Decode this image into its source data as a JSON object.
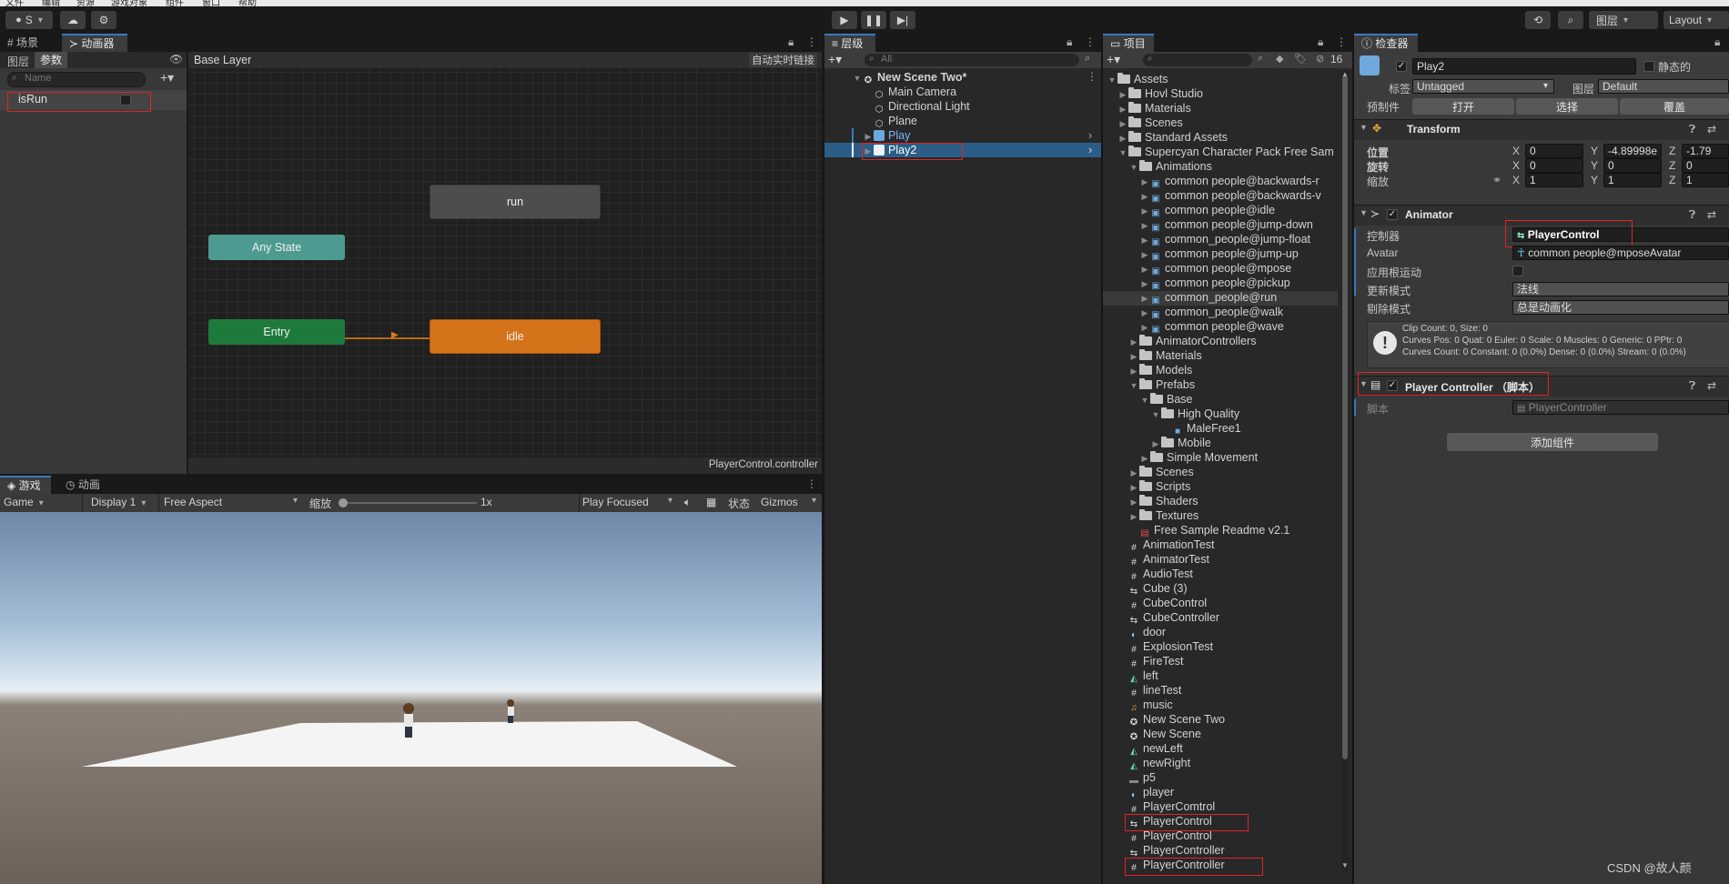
{
  "menubar": {
    "items": [
      "文件",
      "编辑",
      "资源",
      "游戏对象",
      "组件",
      "窗口",
      "帮助"
    ]
  },
  "toolbar": {
    "account": "S",
    "layers_label": "图层",
    "layout_label": "Layout"
  },
  "animator": {
    "tabs": [
      "场景",
      "动画器"
    ],
    "subtabs": [
      "图层",
      "参数"
    ],
    "breadcrumb": "Base Layer",
    "auto_live_link": "自动实时链接",
    "search_placeholder": "Name",
    "parameters": [
      {
        "name": "isRun",
        "type": "bool",
        "value": false
      }
    ],
    "states": {
      "run": "run",
      "any": "Any State",
      "entry": "Entry",
      "idle": "idle"
    },
    "footer": "PlayerControl.controller"
  },
  "game": {
    "tabs": [
      "游戏",
      "动画"
    ],
    "display_mode": "Game",
    "display": "Display 1",
    "aspect": "Free Aspect",
    "scale_label": "缩放",
    "scale_value": "1x",
    "play_mode": "Play Focused",
    "stats": "状态",
    "gizmos": "Gizmos"
  },
  "hierarchy": {
    "tab": "层级",
    "search_placeholder": "All",
    "scene": "New Scene Two*",
    "items": [
      "Main Camera",
      "Directional Light",
      "Plane",
      "Play",
      "Play2"
    ]
  },
  "project": {
    "tab": "项目",
    "hidden_count": "16",
    "tree": [
      {
        "label": "Assets",
        "depth": 0,
        "kind": "folder",
        "open": true
      },
      {
        "label": "Hovl Studio",
        "depth": 1,
        "kind": "folder"
      },
      {
        "label": "Materials",
        "depth": 1,
        "kind": "folder"
      },
      {
        "label": "Scenes",
        "depth": 1,
        "kind": "folder"
      },
      {
        "label": "Standard Assets",
        "depth": 1,
        "kind": "folder"
      },
      {
        "label": "Supercyan Character Pack Free Sam",
        "depth": 1,
        "kind": "folder",
        "open": true
      },
      {
        "label": "Animations",
        "depth": 2,
        "kind": "folder",
        "open": true
      },
      {
        "label": "common people@backwards-r",
        "depth": 3,
        "kind": "model"
      },
      {
        "label": "common people@backwards-v",
        "depth": 3,
        "kind": "model"
      },
      {
        "label": "common people@idle",
        "depth": 3,
        "kind": "model"
      },
      {
        "label": "common people@jump-down",
        "depth": 3,
        "kind": "model"
      },
      {
        "label": "common_people@jump-float",
        "depth": 3,
        "kind": "model"
      },
      {
        "label": "common people@jump-up",
        "depth": 3,
        "kind": "model"
      },
      {
        "label": "common people@mpose",
        "depth": 3,
        "kind": "model"
      },
      {
        "label": "common people@pickup",
        "depth": 3,
        "kind": "model"
      },
      {
        "label": "common_people@run",
        "depth": 3,
        "kind": "model"
      },
      {
        "label": "common_people@walk",
        "depth": 3,
        "kind": "model"
      },
      {
        "label": "common people@wave",
        "depth": 3,
        "kind": "model"
      },
      {
        "label": "AnimatorControllers",
        "depth": 2,
        "kind": "folder"
      },
      {
        "label": "Materials",
        "depth": 2,
        "kind": "folder"
      },
      {
        "label": "Models",
        "depth": 2,
        "kind": "folder"
      },
      {
        "label": "Prefabs",
        "depth": 2,
        "kind": "folder",
        "open": true
      },
      {
        "label": "Base",
        "depth": 3,
        "kind": "folder",
        "open": true
      },
      {
        "label": "High Quality",
        "depth": 4,
        "kind": "folder",
        "open": true
      },
      {
        "label": "MaleFree1",
        "depth": 5,
        "kind": "prefab"
      },
      {
        "label": "Mobile",
        "depth": 4,
        "kind": "folder"
      },
      {
        "label": "Simple Movement",
        "depth": 3,
        "kind": "folder"
      },
      {
        "label": "Scenes",
        "depth": 2,
        "kind": "folder"
      },
      {
        "label": "Scripts",
        "depth": 2,
        "kind": "folder"
      },
      {
        "label": "Shaders",
        "depth": 2,
        "kind": "folder"
      },
      {
        "label": "Textures",
        "depth": 2,
        "kind": "folder"
      },
      {
        "label": "Free Sample Readme v2.1",
        "depth": 2,
        "kind": "pdf"
      },
      {
        "label": "AnimationTest",
        "depth": 1,
        "kind": "script"
      },
      {
        "label": "AnimatorTest",
        "depth": 1,
        "kind": "script"
      },
      {
        "label": "AudioTest",
        "depth": 1,
        "kind": "script"
      },
      {
        "label": "Cube (3)",
        "depth": 1,
        "kind": "anim"
      },
      {
        "label": "CubeControl",
        "depth": 1,
        "kind": "script"
      },
      {
        "label": "CubeController",
        "depth": 1,
        "kind": "anim"
      },
      {
        "label": "door",
        "depth": 1,
        "kind": "material"
      },
      {
        "label": "ExplosionTest",
        "depth": 1,
        "kind": "script"
      },
      {
        "label": "FireTest",
        "depth": 1,
        "kind": "script"
      },
      {
        "label": "left",
        "depth": 1,
        "kind": "clip"
      },
      {
        "label": "lineTest",
        "depth": 1,
        "kind": "script"
      },
      {
        "label": "music",
        "depth": 1,
        "kind": "audio"
      },
      {
        "label": "New Scene Two",
        "depth": 1,
        "kind": "scene"
      },
      {
        "label": "New Scene",
        "depth": 1,
        "kind": "scene"
      },
      {
        "label": "newLeft",
        "depth": 1,
        "kind": "clip"
      },
      {
        "label": "newRight",
        "depth": 1,
        "kind": "clip"
      },
      {
        "label": "p5",
        "depth": 1,
        "kind": "texture"
      },
      {
        "label": "player",
        "depth": 1,
        "kind": "material"
      },
      {
        "label": "PlayerComtrol",
        "depth": 1,
        "kind": "script"
      },
      {
        "label": "PlayerControl",
        "depth": 1,
        "kind": "anim"
      },
      {
        "label": "PlayerControl",
        "depth": 1,
        "kind": "script"
      },
      {
        "label": "PlayerController",
        "depth": 1,
        "kind": "anim"
      },
      {
        "label": "PlayerController",
        "depth": 1,
        "kind": "script"
      }
    ]
  },
  "inspector": {
    "tab": "检查器",
    "object_name": "Play2",
    "static_label": "静态的",
    "tag_label": "标签",
    "tag_value": "Untagged",
    "layer_label": "图层",
    "layer_value": "Default",
    "prefab_label": "预制件",
    "prefab_buttons": [
      "打开",
      "选择",
      "覆盖"
    ],
    "transform": {
      "title": "Transform",
      "position_label": "位置",
      "position": [
        "0",
        "-4.89998e",
        "-1.79"
      ],
      "rotation_label": "旋转",
      "rotation": [
        "0",
        "0",
        "0"
      ],
      "scale_label": "缩放",
      "scale": [
        "1",
        "1",
        "1"
      ]
    },
    "animator": {
      "title": "Animator",
      "controller_label": "控制器",
      "controller_value": "PlayerControl",
      "avatar_label": "Avatar",
      "avatar_value": "common people@mposeAvatar",
      "root_motion_label": "应用根运动",
      "update_mode_label": "更新模式",
      "update_mode_value": "法线",
      "culling_label": "剔除模式",
      "culling_value": "总是动画化",
      "info": [
        "Clip Count: 0, Size: 0",
        "Curves Pos: 0 Quat: 0 Euler: 0 Scale: 0 Muscles: 0 Generic: 0 PPtr: 0",
        "Curves Count: 0 Constant: 0 (0.0%) Dense: 0 (0.0%) Stream: 0 (0.0%)"
      ]
    },
    "player_controller": {
      "title": "Player Controller （脚本）",
      "script_label": "脚本",
      "script_value": "PlayerController"
    },
    "add_component": "添加组件"
  },
  "watermark": "CSDN @故人颜",
  "colors": {
    "selection": "#2c5d87",
    "accent_blue": "#3a79bb",
    "highlight_red": "#e02424",
    "state_entry": "#1e7a3c",
    "state_any": "#4d9b90",
    "state_idle": "#d5731a",
    "state_run": "#4d4d4d"
  }
}
